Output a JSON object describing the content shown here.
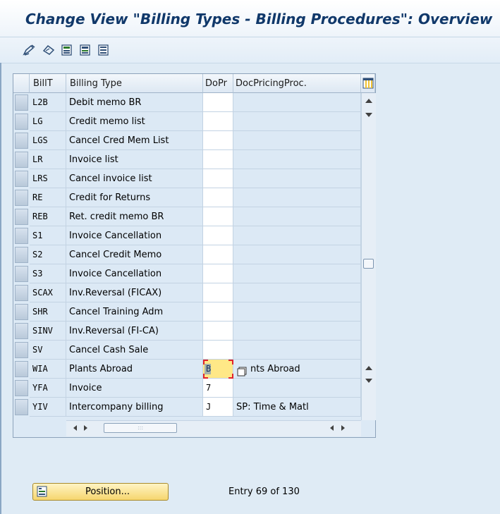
{
  "window": {
    "title": "Change View \"Billing Types - Billing Procedures\": Overview"
  },
  "toolbar": {
    "icons": [
      "edit-pencil-icon",
      "undo-icon",
      "select-all-icon",
      "deselect-icon",
      "select-block-icon"
    ]
  },
  "table": {
    "columns": [
      "BillT",
      "Billing Type",
      "DoPr",
      "DocPricingProc."
    ],
    "rows": [
      {
        "code": "L2B",
        "desc": "Debit memo BR",
        "dopr": "",
        "proc": ""
      },
      {
        "code": "LG",
        "desc": "Credit memo list",
        "dopr": "",
        "proc": ""
      },
      {
        "code": "LGS",
        "desc": "Cancel Cred Mem List",
        "dopr": "",
        "proc": ""
      },
      {
        "code": "LR",
        "desc": "Invoice list",
        "dopr": "",
        "proc": ""
      },
      {
        "code": "LRS",
        "desc": "Cancel invoice list",
        "dopr": "",
        "proc": ""
      },
      {
        "code": "RE",
        "desc": "Credit for Returns",
        "dopr": "",
        "proc": ""
      },
      {
        "code": "REB",
        "desc": "Ret. credit memo BR",
        "dopr": "",
        "proc": ""
      },
      {
        "code": "S1",
        "desc": "Invoice Cancellation",
        "dopr": "",
        "proc": ""
      },
      {
        "code": "S2",
        "desc": "Cancel Credit Memo",
        "dopr": "",
        "proc": ""
      },
      {
        "code": "S3",
        "desc": "Invoice Cancellation",
        "dopr": "",
        "proc": ""
      },
      {
        "code": "SCAX",
        "desc": "Inv.Reversal (FICAX)",
        "dopr": "",
        "proc": ""
      },
      {
        "code": "SHR",
        "desc": "Cancel Training Adm",
        "dopr": "",
        "proc": ""
      },
      {
        "code": "SINV",
        "desc": "Inv.Reversal (FI-CA)",
        "dopr": "",
        "proc": ""
      },
      {
        "code": "SV",
        "desc": "Cancel Cash Sale",
        "dopr": "",
        "proc": ""
      },
      {
        "code": "WIA",
        "desc": "Plants Abroad",
        "dopr": "B",
        "proc": "nts Abroad",
        "focused": true
      },
      {
        "code": "YFA",
        "desc": "Invoice",
        "dopr": "7",
        "proc": ""
      },
      {
        "code": "YIV",
        "desc": "Intercompany billing",
        "dopr": "J",
        "proc": "SP: Time & Matl"
      }
    ]
  },
  "footer": {
    "position_button": "Position...",
    "entry_text": "Entry 69 of 130"
  },
  "colors": {
    "title": "#10386a",
    "focus_cell": "#ffe887",
    "focus_marker": "#e0232b",
    "background": "#dfebf5"
  }
}
